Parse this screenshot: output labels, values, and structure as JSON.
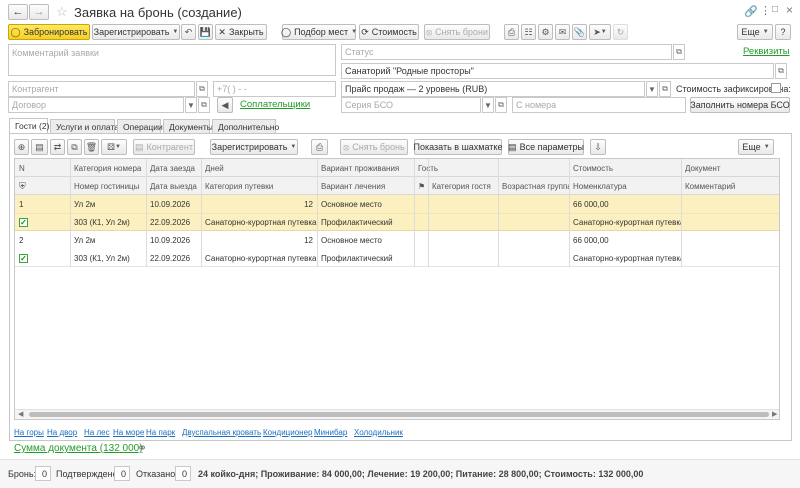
{
  "window": {
    "title": "Заявка на бронь (создание)"
  },
  "toolbar": {
    "book": "Забронировать",
    "register": "Зарегистрировать",
    "close": "Закрыть",
    "pick_places": "Подбор мест",
    "cost": "Стоимость",
    "cancel_bookings": "Снять брони",
    "more": "Еще"
  },
  "form": {
    "comment_placeholder": "Комментарий заявки",
    "status_placeholder": "Статус",
    "requisites_link": "Реквизиты",
    "sanatorium_value": "Санаторий \"Родные просторы\"",
    "contractor_placeholder": "Контрагент",
    "phone_placeholder": "+7(   )    -   -",
    "price_value": "Прайс продаж — 2 уровень (RUB)",
    "cost_fixed_label": "Стоимость зафиксирована:",
    "contract_placeholder": "Договор",
    "copayers_link": "Соплательщики",
    "bso_series_placeholder": "Серия БСО",
    "bso_number_placeholder": "С номера",
    "fill_bso_button": "Заполнить номера БСО"
  },
  "tabs": [
    {
      "label": "Гости (2)"
    },
    {
      "label": "Услуги и оплата"
    },
    {
      "label": "Операции"
    },
    {
      "label": "Документы"
    },
    {
      "label": "Дополнительно"
    }
  ],
  "tab_toolbar": {
    "contractor": "Контрагент",
    "register": "Зарегистрировать",
    "cancel_booking": "Снять бронь",
    "show_chess": "Показать в шахматке",
    "all_params": "Все параметры",
    "more": "Еще"
  },
  "grid": {
    "headers_top": [
      "N",
      "Категория номера",
      "Дата заезда",
      "Дней",
      "Вариант проживания",
      "Гость",
      "Стоимость",
      "Документ"
    ],
    "headers_bottom": [
      "Номер гостиницы",
      "Дата выезда",
      "Категория путевки",
      "Вариант лечения",
      "Категория гостя",
      "Возрастная группа",
      "Номенклатура",
      "Комментарий"
    ],
    "rows": [
      {
        "n": "1",
        "category": "Ул 2м",
        "arrival": "10.09.2026",
        "days": "12",
        "stay": "Основное место",
        "cost": "66 000,00",
        "room": "303 (К1, Ул 2м)",
        "departure": "22.09.2026",
        "voucher": "Санаторно-курортная путевка",
        "treatment": "Профилактический",
        "item": "Санаторно-курортная путевка",
        "checked": true
      },
      {
        "n": "2",
        "category": "Ул 2м",
        "arrival": "10.09.2026",
        "days": "12",
        "stay": "Основное место",
        "cost": "66 000,00",
        "room": "303 (К1, Ул 2м)",
        "departure": "22.09.2026",
        "voucher": "Санаторно-курортная путевка",
        "treatment": "Профилактический",
        "item": "Санаторно-курортная путевка",
        "checked": true
      }
    ]
  },
  "tags": [
    "На горы",
    "На двор",
    "На лес",
    "На море",
    "На парк",
    "Двуспальная кровать",
    "Кондиционер",
    "Минибар",
    "Холодильник"
  ],
  "sum_link": "Сумма документа (132 000)",
  "footer": {
    "bron_label": "Бронь:",
    "bron_value": "0",
    "confirmed_label": "Подтверждено:",
    "confirmed_value": "0",
    "refused_label": "Отказано:",
    "refused_value": "0",
    "summary": "24 койко-дня; Проживание: 84 000,00; Лечение: 19 200,00; Питание: 28 800,00; Стоимость: 132 000,00"
  }
}
